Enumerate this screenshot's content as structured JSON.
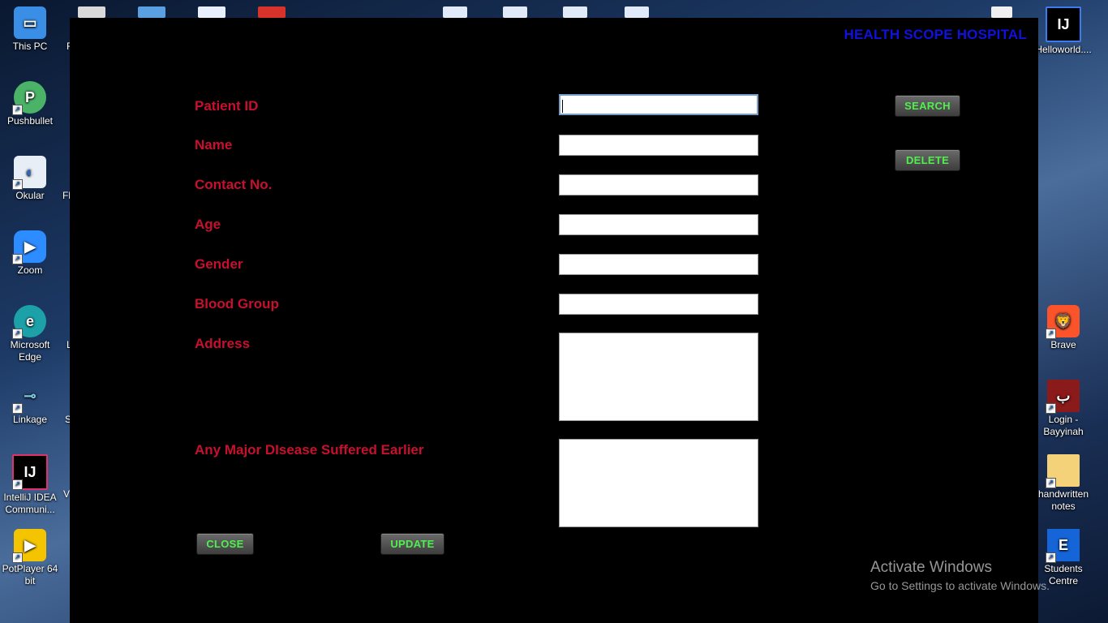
{
  "desktop": {
    "left_icons": [
      {
        "label": "This PC",
        "icon": "computer-icon",
        "color": "#3a8ee6"
      },
      {
        "label": "Pushbullet",
        "icon": "pushbullet-icon",
        "color": "#4ab367"
      },
      {
        "label": "Okular",
        "icon": "okular-icon",
        "color": "#e8eef6"
      },
      {
        "label": "Zoom",
        "icon": "zoom-icon",
        "color": "#2d8cff"
      },
      {
        "label": "Microsoft Edge",
        "icon": "edge-icon",
        "color": "#1da1a8"
      },
      {
        "label": "Linkage",
        "icon": "linkage-icon",
        "color": "#7ec8e3"
      },
      {
        "label": "IntelliJ IDEA Communi...",
        "icon": "intellij-icon",
        "color": "#000000"
      },
      {
        "label": "PotPlayer 64 bit",
        "icon": "potplayer-icon",
        "color": "#f5c400"
      }
    ],
    "right_icons": [
      {
        "label": "Helloworld....",
        "icon": "intellij-icon",
        "color": "#000000"
      },
      {
        "label": "Brave",
        "icon": "brave-lion-icon",
        "color": "#fb542b"
      },
      {
        "label": "Login - Bayyinah",
        "icon": "bayyinah-icon",
        "color": "#8b1a1a"
      },
      {
        "label": "handwritten notes",
        "icon": "folder-icon",
        "color": "#f3d27a"
      },
      {
        "label": "Students Centre",
        "icon": "letter-e-icon",
        "color": "#1565d8"
      }
    ],
    "partial_letters": [
      "F",
      "Fl",
      "L",
      "S",
      "V"
    ]
  },
  "app": {
    "title": "HEALTH SCOPE HOSPITAL",
    "fields": {
      "patient_id": {
        "label": "Patient ID",
        "value": ""
      },
      "name": {
        "label": "Name",
        "value": ""
      },
      "contact": {
        "label": "Contact No.",
        "value": ""
      },
      "age": {
        "label": "Age",
        "value": ""
      },
      "gender": {
        "label": "Gender",
        "value": ""
      },
      "blood_group": {
        "label": "Blood Group",
        "value": ""
      },
      "address": {
        "label": "Address",
        "value": ""
      },
      "disease": {
        "label": "Any Major DIsease Suffered Earlier",
        "value": ""
      }
    },
    "buttons": {
      "search": "SEARCH",
      "delete": "DELETE",
      "close": "CLOSE",
      "update": "UPDATE"
    }
  },
  "watermark": {
    "title": "Activate Windows",
    "subtitle": "Go to Settings to activate Windows."
  },
  "colors": {
    "label_red": "#c8102e",
    "title_blue": "#1010e0",
    "button_text_green": "#4ef04e",
    "window_bg": "#000000"
  }
}
